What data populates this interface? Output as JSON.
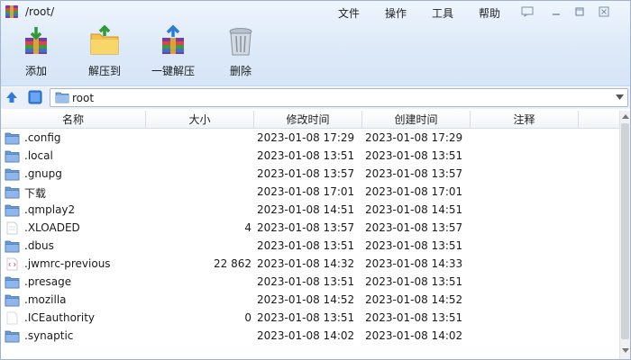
{
  "window": {
    "title": "/root/",
    "menu": [
      "文件",
      "操作",
      "工具",
      "帮助"
    ]
  },
  "toolbar": {
    "add_label": "添加",
    "extract_to_label": "解压到",
    "one_click_extract_label": "一键解压",
    "delete_label": "删除"
  },
  "address": {
    "path": "root"
  },
  "columns": {
    "name": "名称",
    "size": "大小",
    "modified": "修改时间",
    "created": "创建时间",
    "comment": "注释"
  },
  "files": [
    {
      "name": ".config",
      "size": "",
      "modified": "2023-01-08 17:29",
      "created": "2023-01-08 17:29",
      "icon": "folder-icon"
    },
    {
      "name": ".local",
      "size": "",
      "modified": "2023-01-08 13:51",
      "created": "2023-01-08 13:51",
      "icon": "folder-icon"
    },
    {
      "name": ".gnupg",
      "size": "",
      "modified": "2023-01-08 13:57",
      "created": "2023-01-08 13:57",
      "icon": "folder-icon"
    },
    {
      "name": "下载",
      "size": "",
      "modified": "2023-01-08 17:01",
      "created": "2023-01-08 17:01",
      "icon": "folder-icon"
    },
    {
      "name": ".qmplay2",
      "size": "",
      "modified": "2023-01-08 14:51",
      "created": "2023-01-08 14:51",
      "icon": "folder-icon"
    },
    {
      "name": ".XLOADED",
      "size": "4",
      "modified": "2023-01-08 13:57",
      "created": "2023-01-08 13:57",
      "icon": "file-icon"
    },
    {
      "name": ".dbus",
      "size": "",
      "modified": "2023-01-08 13:51",
      "created": "2023-01-08 13:51",
      "icon": "folder-icon"
    },
    {
      "name": ".jwmrc-previous",
      "size": "22 862",
      "modified": "2023-01-08 14:32",
      "created": "2023-01-08 14:33",
      "icon": "code-file-icon"
    },
    {
      "name": ".presage",
      "size": "",
      "modified": "2023-01-08 13:51",
      "created": "2023-01-08 13:51",
      "icon": "folder-icon"
    },
    {
      "name": ".mozilla",
      "size": "",
      "modified": "2023-01-08 14:52",
      "created": "2023-01-08 14:52",
      "icon": "folder-icon"
    },
    {
      "name": ".ICEauthority",
      "size": "0",
      "modified": "2023-01-08 13:51",
      "created": "2023-01-08 13:51",
      "icon": "blank-file-icon"
    },
    {
      "name": ".synaptic",
      "size": "",
      "modified": "2023-01-08 14:02",
      "created": "2023-01-08 14:02",
      "icon": "folder-icon"
    }
  ],
  "colors": {
    "folder": "#5b8fd0",
    "band_top": "#eef5fd",
    "band_bottom": "#d6e5f7",
    "accent": "#2f7bd8"
  }
}
